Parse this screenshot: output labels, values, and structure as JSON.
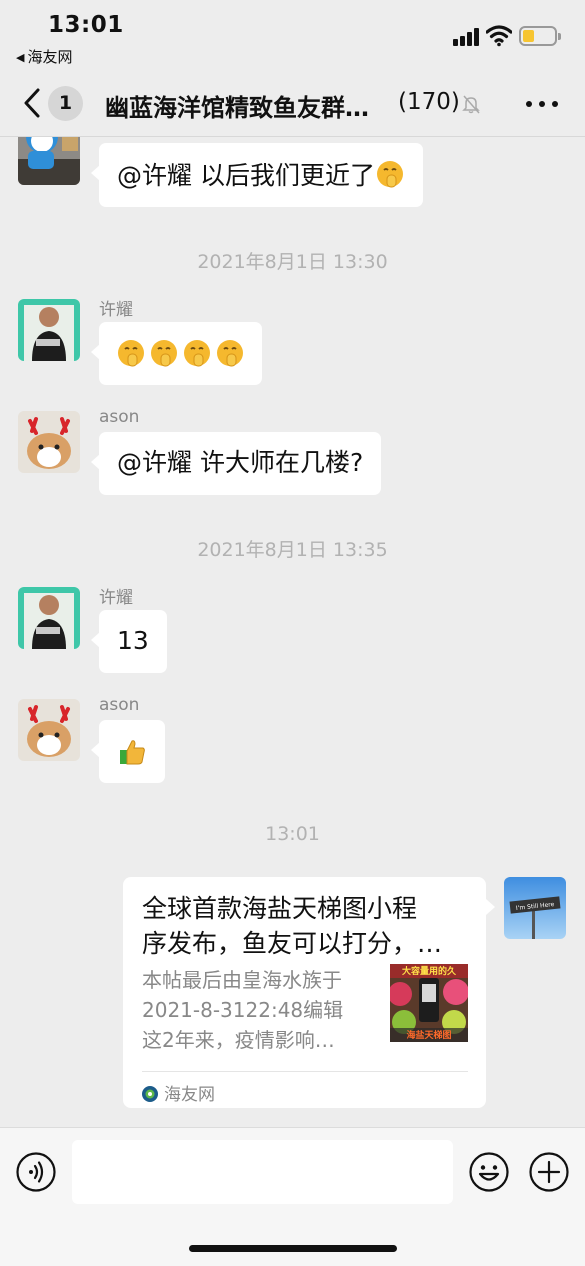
{
  "status_bar": {
    "time": "13:01",
    "back_app": "海友网"
  },
  "header": {
    "unread_count": "1",
    "title": "幽蓝海洋馆精致鱼友群…",
    "member_count": "(170)"
  },
  "messages": [
    {
      "type": "text",
      "side": "left",
      "sender": "",
      "text": "@许耀 以后我们更近了",
      "emoji": "shush-emoji",
      "emoji_count": 1
    },
    {
      "type": "timestamp",
      "text": "2021年8月1日 13:30"
    },
    {
      "type": "text",
      "side": "left",
      "sender": "许耀",
      "text": "",
      "emoji": "shush-emoji",
      "emoji_count": 4
    },
    {
      "type": "text",
      "side": "left",
      "sender": "ason",
      "text": "@许耀 许大师在几楼?"
    },
    {
      "type": "timestamp",
      "text": "2021年8月1日 13:35"
    },
    {
      "type": "text",
      "side": "left",
      "sender": "许耀",
      "text": "13"
    },
    {
      "type": "text",
      "side": "left",
      "sender": "ason",
      "text": "",
      "emoji": "thumbs-up-emoji",
      "emoji_count": 1
    },
    {
      "type": "timestamp",
      "text": "13:01"
    }
  ],
  "card": {
    "title_line1": "全球首款海盐天梯图小程",
    "title_line2": "序发布，鱼友可以打分，…",
    "desc_line1": "本帖最后由皇海水族于",
    "desc_line2": "2021-8-3122:48编辑",
    "desc_line3": "这2年来，疫情影响…",
    "thumb_text_top": "大容量用的久",
    "thumb_text_bottom": "海盐天梯图",
    "thumb_sign": "I'm Still Here",
    "source": "海友网"
  },
  "input": {
    "placeholder": ""
  },
  "colors": {
    "background": "#ededed",
    "bubble": "#ffffff",
    "timestamp": "#b2b2b2",
    "battery": "#f7c531"
  }
}
